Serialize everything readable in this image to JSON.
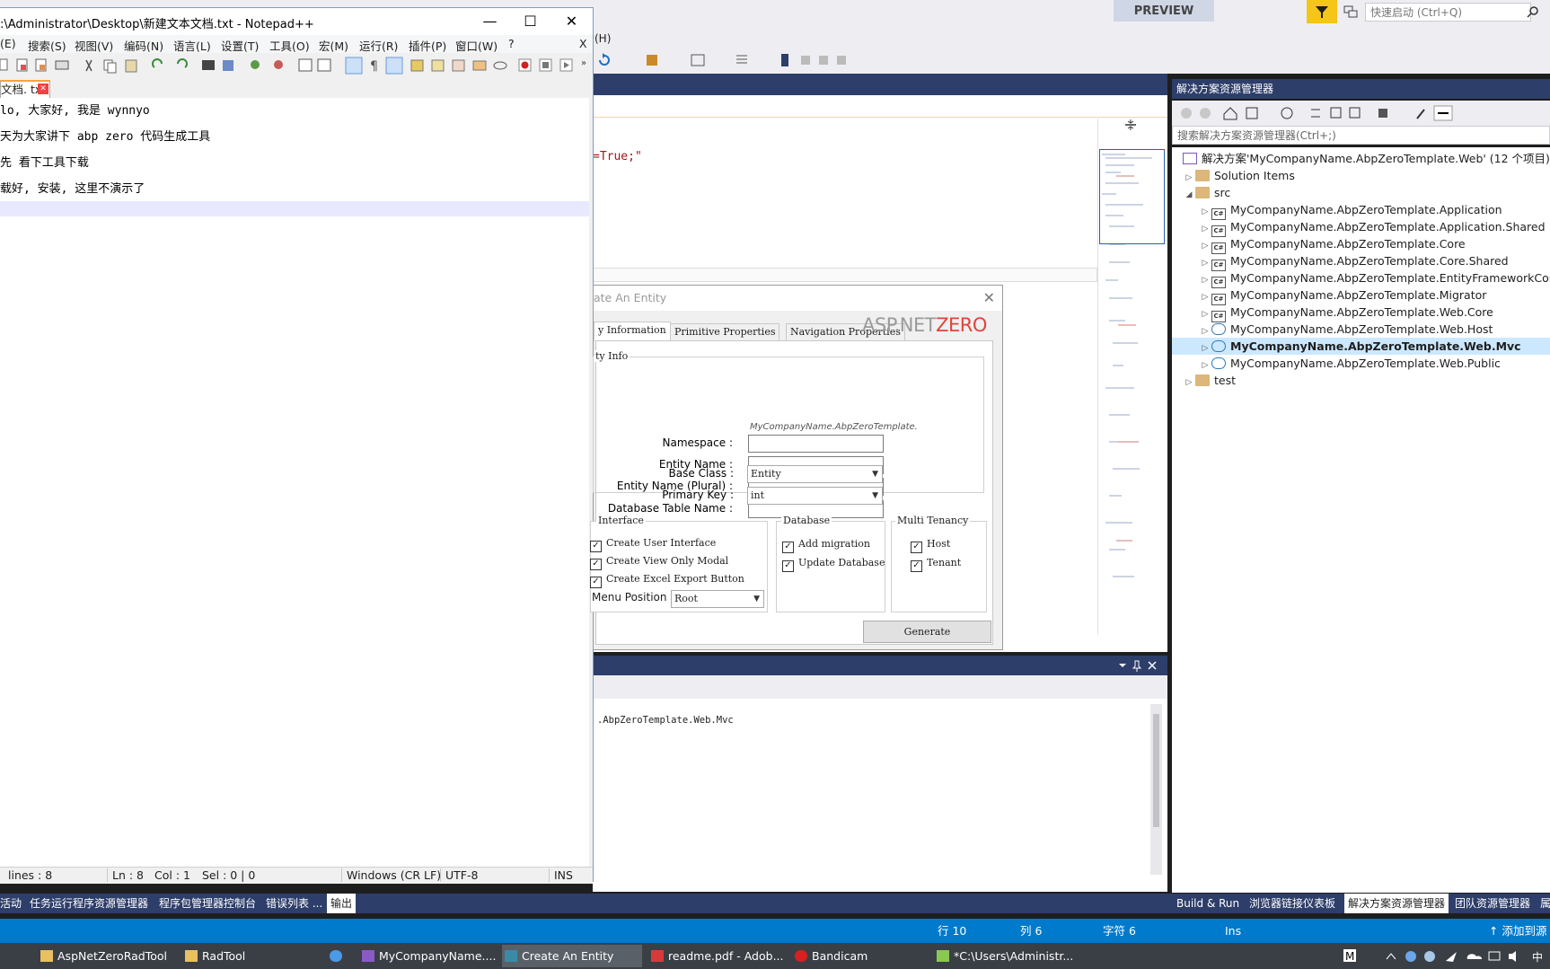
{
  "vs": {
    "preview_label": "PREVIEW",
    "quick_launch_placeholder": "快速启动 (Ctrl+Q)",
    "help_menu_fragment": "助(H)",
    "code_fragment": "=True;\"",
    "output_text": ".AbpZeroTemplate.Web.Mvc"
  },
  "solution_explorer": {
    "title": "解决方案资源管理器",
    "search_placeholder": "搜索解决方案资源管理器(Ctrl+;)",
    "solution": "解决方案'MyCompanyName.AbpZeroTemplate.Web' (12 个项目)",
    "items": [
      {
        "label": "Solution Items",
        "kind": "folder",
        "level": 1,
        "expander": "▷"
      },
      {
        "label": "src",
        "kind": "folder",
        "level": 1,
        "expander": "◢"
      },
      {
        "label": "MyCompanyName.AbpZeroTemplate.Application",
        "kind": "cs",
        "level": 2,
        "expander": "▷"
      },
      {
        "label": "MyCompanyName.AbpZeroTemplate.Application.Shared",
        "kind": "cs",
        "level": 2,
        "expander": "▷"
      },
      {
        "label": "MyCompanyName.AbpZeroTemplate.Core",
        "kind": "cs",
        "level": 2,
        "expander": "▷"
      },
      {
        "label": "MyCompanyName.AbpZeroTemplate.Core.Shared",
        "kind": "cs",
        "level": 2,
        "expander": "▷"
      },
      {
        "label": "MyCompanyName.AbpZeroTemplate.EntityFrameworkCore",
        "kind": "cs",
        "level": 2,
        "expander": "▷"
      },
      {
        "label": "MyCompanyName.AbpZeroTemplate.Migrator",
        "kind": "cs",
        "level": 2,
        "expander": "▷"
      },
      {
        "label": "MyCompanyName.AbpZeroTemplate.Web.Core",
        "kind": "cs",
        "level": 2,
        "expander": "▷"
      },
      {
        "label": "MyCompanyName.AbpZeroTemplate.Web.Host",
        "kind": "web",
        "level": 2,
        "expander": "▷"
      },
      {
        "label": "MyCompanyName.AbpZeroTemplate.Web.Mvc",
        "kind": "web",
        "level": 2,
        "expander": "▷",
        "selected": true
      },
      {
        "label": "MyCompanyName.AbpZeroTemplate.Web.Public",
        "kind": "web",
        "level": 2,
        "expander": "▷"
      },
      {
        "label": "test",
        "kind": "folder",
        "level": 1,
        "expander": "▷"
      }
    ],
    "tabs": [
      "Build & Run",
      "浏览器链接仪表板",
      "解决方案资源管理器",
      "团队资源管理器",
      "属"
    ]
  },
  "bottom_tabs": [
    "活动",
    "任务运行程序资源管理器",
    "程序包管理器控制台",
    "错误列表 ...",
    "输出"
  ],
  "statusbar": {
    "row": "行 10",
    "col": "列 6",
    "char": "字符 6",
    "ins": "Ins",
    "publish": "↑  添加到源"
  },
  "taskbar": [
    {
      "label": "AspNetZeroRadTool",
      "icon": "folder-icon"
    },
    {
      "label": "RadTool",
      "icon": "folder-icon"
    },
    {
      "label": "",
      "icon": "chrome-icon"
    },
    {
      "label": "MyCompanyName....",
      "icon": "visual-studio-icon"
    },
    {
      "label": "Create An Entity",
      "icon": "app-icon"
    },
    {
      "label": "readme.pdf - Adob...",
      "icon": "pdf-icon"
    },
    {
      "label": "Bandicam",
      "icon": "record-icon"
    },
    {
      "label": "*C:\\Users\\Administr...",
      "icon": "notepad-icon"
    }
  ],
  "notepad": {
    "title": ":\\Administrator\\Desktop\\新建文本文档.txt - Notepad++",
    "menu": [
      "(E)",
      "搜索(S)",
      "视图(V)",
      "编码(N)",
      "语言(L)",
      "设置(T)",
      "工具(O)",
      "宏(M)",
      "运行(R)",
      "插件(P)",
      "窗口(W)",
      "?"
    ],
    "menu_close": "X",
    "tab_label": "文档. txt",
    "lines": [
      "lo, 大家好, 我是 wynnyo",
      "天为大家讲下 abp zero 代码生成工具",
      "先 看下工具下载",
      "载好, 安装, 这里不演示了"
    ],
    "status": {
      "lines": "lines : 8",
      "ln": "Ln : 8",
      "col": "Col : 1",
      "sel": "Sel : 0 | 0",
      "eol": "Windows (CR LF)",
      "encoding": "UTF-8",
      "mode": "INS"
    }
  },
  "dialog": {
    "title": "ate An Entity",
    "tabs": [
      "y Information",
      "Primitive Properties",
      "Navigation Properties"
    ],
    "logo_a": "ASP.NET",
    "logo_b": "ZERO",
    "entity_info_title": "ty Info",
    "namespace_hint": "MyCompanyName.AbpZeroTemplate.",
    "fields": {
      "namespace": "Namespace :",
      "entity_name": "Entity Name :",
      "entity_plural": "Entity Name (Plural) :",
      "table_name": "Database Table Name :",
      "base_class": "Base Class :",
      "primary_key": "Primary Key :"
    },
    "base_class_value": "Entity",
    "primary_key_value": "int",
    "ui_group": {
      "title": "Interface",
      "create_ui": "Create User Interface",
      "view_only": "Create View Only Modal",
      "excel": "Create Excel Export Button",
      "menu_position_label": "Menu Position :",
      "menu_position_value": "Root"
    },
    "db_group": {
      "title": "Database",
      "add_migration": "Add migration",
      "update_db": "Update Database"
    },
    "mt_group": {
      "title": "Multi Tenancy",
      "host": "Host",
      "tenant": "Tenant"
    },
    "generate": "Generate"
  }
}
